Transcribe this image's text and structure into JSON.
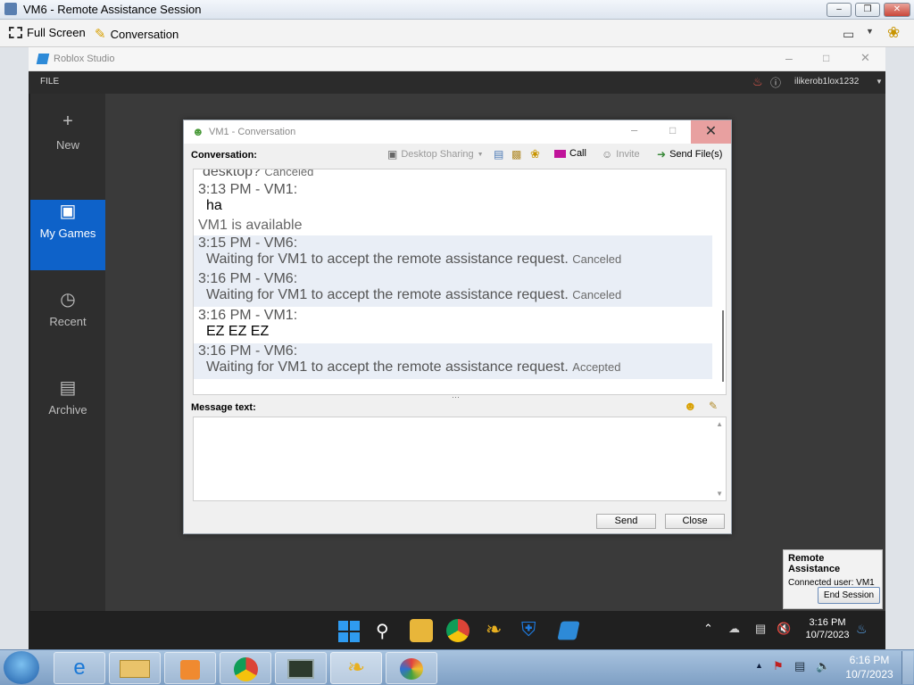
{
  "host": {
    "title": "VM6 - Remote Assistance Session",
    "toolbar": {
      "fullscreen": "Full Screen",
      "conversation": "Conversation"
    },
    "minimize": "–",
    "restore": "❒",
    "close": "✕"
  },
  "roblox": {
    "title": "Roblox Studio",
    "menu": {
      "file": "FILE"
    },
    "username": "ilikerob1lox1232",
    "sidebar": [
      {
        "label": "New",
        "icon": "+"
      },
      {
        "label": "My Games",
        "icon": "▣"
      },
      {
        "label": "Recent",
        "icon": "◷"
      },
      {
        "label": "Archive",
        "icon": "▤"
      }
    ]
  },
  "conversation": {
    "title": "VM1 - Conversation",
    "label": "Conversation:",
    "toolbar": {
      "desktop_sharing": "Desktop Sharing",
      "call": "Call",
      "invite": "Invite",
      "send_files": "Send File(s)"
    },
    "messages": [
      {
        "time": "",
        "body": "desktop?",
        "status": "Canceled"
      },
      {
        "time": "3:13 PM - VM1:",
        "body": "ha",
        "status": ""
      },
      {
        "time": "",
        "body": "VM1 is available",
        "status": ""
      },
      {
        "time": "3:15 PM - VM6:",
        "body": "Waiting for VM1 to accept the remote assistance request.",
        "status": "Canceled"
      },
      {
        "time": "3:16 PM - VM6:",
        "body": "Waiting for VM1 to accept the remote assistance request.",
        "status": "Canceled"
      },
      {
        "time": "3:16 PM - VM1:",
        "body": "EZ EZ EZ",
        "status": ""
      },
      {
        "time": "3:16 PM - VM6:",
        "body": "Waiting for VM1 to accept the remote assistance request.",
        "status": "Accepted"
      }
    ],
    "message_label": "Message text:",
    "send": "Send",
    "close": "Close"
  },
  "remote_assistance": {
    "title": "Remote Assistance",
    "connected": "Connected user:  VM1",
    "end": "End Session"
  },
  "vm_tray": {
    "time": "3:16 PM",
    "date": "10/7/2023"
  },
  "host_tray": {
    "time": "6:16 PM",
    "date": "10/7/2023"
  }
}
